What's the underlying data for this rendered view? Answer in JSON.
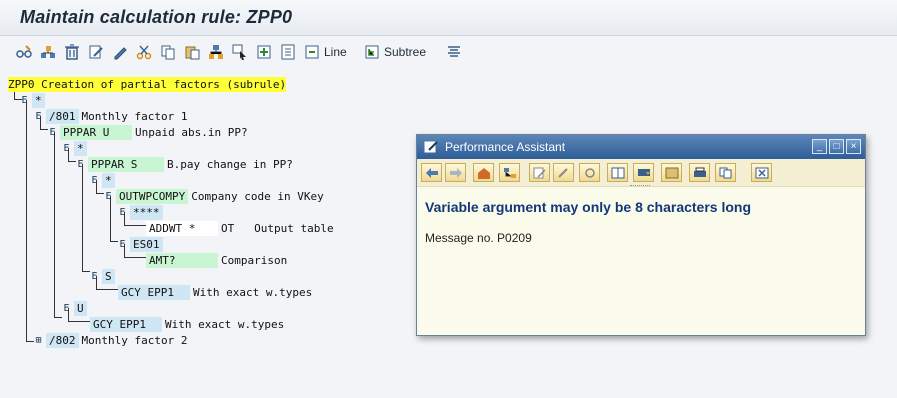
{
  "window": {
    "title": "Maintain calculation rule: ZPP0"
  },
  "toolbar": {
    "buttons": [
      {
        "icon": "glasses-icon"
      },
      {
        "icon": "hierarchy-icon"
      },
      {
        "icon": "trash-icon"
      },
      {
        "icon": "edit-icon"
      },
      {
        "icon": "pencil-icon"
      },
      {
        "icon": "scissors-icon"
      },
      {
        "icon": "copy-icon"
      },
      {
        "icon": "paste-icon"
      },
      {
        "icon": "tree-move-icon"
      },
      {
        "icon": "cursor-select-icon"
      },
      {
        "icon": "insert-icon"
      },
      {
        "icon": "insert-doc-icon"
      },
      {
        "icon": "line-icon",
        "label": "Line"
      },
      {
        "icon": "subtree-icon",
        "label": "Subtree"
      },
      {
        "icon": "align-icon"
      }
    ]
  },
  "tree": {
    "root": {
      "code": "ZPP0",
      "text": "Creation of partial factors (subrule)"
    },
    "nodes": [
      {
        "exp": "E",
        "code": "*",
        "text": ""
      },
      {
        "exp": "E",
        "code": "/801",
        "text": "Monthly factor 1"
      },
      {
        "exp": "E",
        "code": "PPPAR U",
        "text": "Unpaid abs.in PP?"
      },
      {
        "exp": "E",
        "code": "*",
        "text": ""
      },
      {
        "exp": "E",
        "code": "PPPAR S",
        "text": "B.pay change in PP?"
      },
      {
        "exp": "E",
        "code": "*",
        "text": ""
      },
      {
        "exp": "E",
        "code": "OUTWPCOMPY",
        "text": "Company code in VKey"
      },
      {
        "exp": "E",
        "code": "****",
        "text": ""
      },
      {
        "exp": "",
        "code": "ADDWT *",
        "text": "OT   Output table"
      },
      {
        "exp": "E",
        "code": "ES01",
        "text": ""
      },
      {
        "exp": "",
        "code": "AMT?",
        "text": "Comparison"
      },
      {
        "exp": "E",
        "code": "S",
        "text": ""
      },
      {
        "exp": "",
        "code": "GCY EPP1",
        "text": "With exact w.types"
      },
      {
        "exp": "E",
        "code": "U",
        "text": ""
      },
      {
        "exp": "",
        "code": "GCY EPP1",
        "text": "With exact w.types"
      },
      {
        "exp": "⊞",
        "code": "/802",
        "text": "Monthly factor 2"
      }
    ]
  },
  "dialog": {
    "title": "Performance Assistant",
    "message": "Variable argument may only be 8 characters long",
    "message_no": "Message no. P0209",
    "window_buttons": [
      "_",
      "□",
      "×"
    ],
    "toolbar_icons": [
      "back-icon",
      "forward-icon",
      "home-icon",
      "structure-icon",
      "edit-icon",
      "tools-icon",
      "settings-icon",
      "book-icon",
      "flag-icon",
      "save-icon",
      "print-icon",
      "copy-icon",
      "close-icon"
    ]
  }
}
